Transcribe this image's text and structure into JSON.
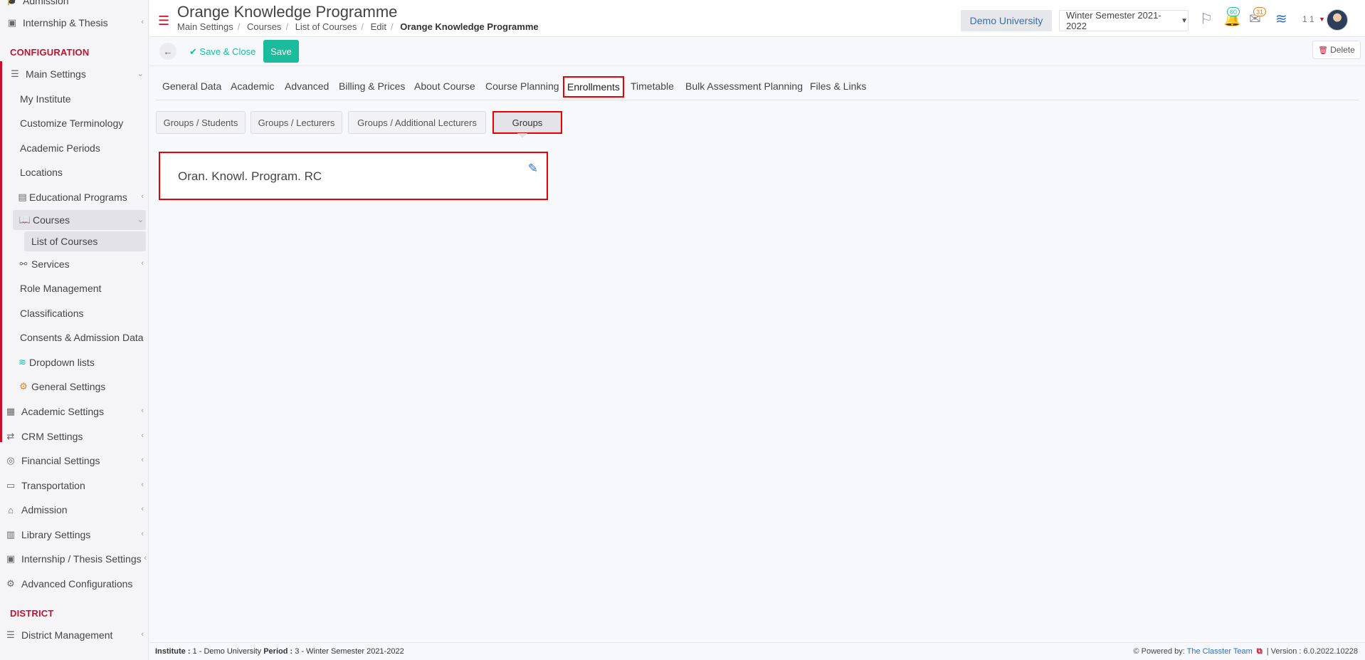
{
  "sidebar": {
    "top_items": [
      {
        "label": "Admission",
        "icon": "cap-icon"
      },
      {
        "label": "Internship & Thesis",
        "icon": "box-icon"
      }
    ],
    "configuration_title": "CONFIGURATION",
    "main_settings": {
      "label": "Main Settings",
      "icon": "sliders-icon"
    },
    "main_children": [
      {
        "label": "My Institute"
      },
      {
        "label": "Customize Terminology"
      },
      {
        "label": "Academic Periods"
      },
      {
        "label": "Locations"
      },
      {
        "label": "Educational Programs",
        "icon": "programs-icon"
      },
      {
        "label": "Courses",
        "icon": "book-icon"
      },
      {
        "label": "List of Courses"
      },
      {
        "label": "Services",
        "icon": "services-icon"
      },
      {
        "label": "Role Management"
      },
      {
        "label": "Classifications"
      },
      {
        "label": "Consents & Admission Data"
      },
      {
        "label": "Dropdown lists",
        "icon": "layers-icon"
      },
      {
        "label": "General Settings",
        "icon": "gears-icon"
      }
    ],
    "lower_items": [
      {
        "label": "Academic Settings",
        "icon": "grid-icon"
      },
      {
        "label": "CRM Settings",
        "icon": "shuffle-icon"
      },
      {
        "label": "Financial Settings",
        "icon": "coins-icon"
      },
      {
        "label": "Transportation",
        "icon": "bus-icon"
      },
      {
        "label": "Admission",
        "icon": "bank-icon"
      },
      {
        "label": "Library Settings",
        "icon": "books-icon"
      },
      {
        "label": "Internship / Thesis Settings",
        "icon": "box-icon"
      },
      {
        "label": "Advanced Configurations",
        "icon": "cogs-icon"
      }
    ],
    "district_title": "DISTRICT",
    "district_items": [
      {
        "label": "District Management",
        "icon": "list-icon"
      }
    ]
  },
  "header": {
    "title": "Orange Knowledge Programme",
    "breadcrumb": [
      "Main Settings",
      "Courses",
      "List of Courses",
      "Edit"
    ],
    "breadcrumb_current": "Orange Knowledge Programme",
    "institute": "Demo University",
    "period": "Winter Semester 2021-2022",
    "notifications_count": "60",
    "messages_count": "31",
    "user_number": "1 1"
  },
  "toolbar": {
    "save_close_label": "Save & Close",
    "save_label": "Save",
    "delete_label": "Delete"
  },
  "tabs": [
    "General Data",
    "Academic",
    "Advanced",
    "Billing & Prices",
    "About Course",
    "Course Planning",
    "Enrollments",
    "Timetable",
    "Bulk Assessment Planning",
    "Files & Links"
  ],
  "active_tab": "Enrollments",
  "subtabs": [
    "Groups / Students",
    "Groups / Lecturers",
    "Groups / Additional Lecturers",
    "Groups"
  ],
  "active_subtab": "Groups",
  "groups": [
    {
      "name": "Oran. Knowl. Program. RC"
    }
  ],
  "footer": {
    "institute_label": "Institute :",
    "institute_value": "1 - Demo University",
    "period_label": "Period :",
    "period_value": "3 - Winter Semester 2021-2022",
    "powered_by": "Powered by:",
    "team": "The Classter Team",
    "version": "| Version : 6.0.2022.10228"
  },
  "colors": {
    "accent_red": "#c8102e",
    "highlight_red": "#e00000",
    "save_green": "#1abc9c",
    "link_blue": "#2f6fc5"
  }
}
